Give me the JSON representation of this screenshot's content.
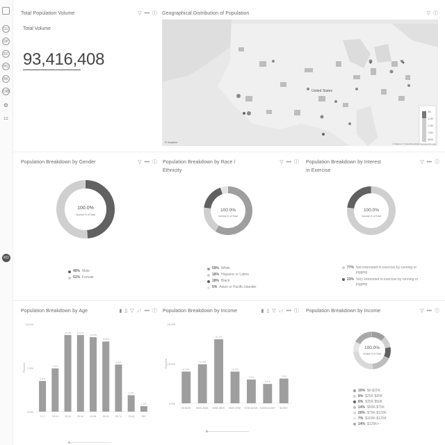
{
  "rail": {
    "items": [
      "CLI",
      "DP",
      "GC",
      "PO",
      "BK",
      "CRB"
    ],
    "user_initials": "KO"
  },
  "tools": {
    "filter": "▽",
    "more": "•••",
    "info": "ⓘ",
    "sort": "↓↑",
    "chart_icon": "▮",
    "grid_icon": "▯"
  },
  "total_volume": {
    "title": "Total Population Volume",
    "label": "Total Volume",
    "value": "93,416,408"
  },
  "map": {
    "title": "Geographical Distribution of Population",
    "country_label": "United States",
    "attribution": "© Mapbox © OpenStreetMap Improve this map",
    "logo": "© mapbox",
    "legend_values": [
      "4M",
      "3.2M",
      "2.4M",
      "1.6M",
      "800K"
    ]
  },
  "gender": {
    "title": "Population Breakdown by Gender",
    "center_value": "100.0%",
    "center_label": "Volume % of Total",
    "legend": [
      {
        "pct": "49%",
        "label": "Male"
      },
      {
        "pct": "51%",
        "label": "Female"
      }
    ]
  },
  "race": {
    "title_line1": "Population Breakdown by Race /",
    "title_line2": "Ethnicity",
    "center_value": "100.0%",
    "center_label": "Volume % of Total",
    "legend": [
      {
        "pct": "59%",
        "label": "White"
      },
      {
        "pct": "18%",
        "label": "Hispanic or Latino"
      },
      {
        "pct": "18%",
        "label": "Black"
      },
      {
        "pct": "5%",
        "label": "Asian or Pacific Islander"
      }
    ]
  },
  "exercise": {
    "title_line1": "Population Breakdown by Interest",
    "title_line2": "in Exercise",
    "center_value": "100.0%",
    "center_label": "Volume % of Total",
    "legend": [
      {
        "pct": "77%",
        "label": "Not interested in exercise by running or jogging"
      },
      {
        "pct": "23%",
        "label": "Very interested in exercise by running or jogging"
      }
    ]
  },
  "income_donut": {
    "title": "Population Breakdown by Income",
    "center_value": "100.0%",
    "center_label": "Volume % of Total",
    "legend": [
      {
        "pct": "10%",
        "label": "$0-$25K"
      },
      {
        "pct": "8%",
        "label": "$25K-$35K"
      },
      {
        "pct": "8%",
        "label": "$35K-$50K"
      },
      {
        "pct": "14%",
        "label": "$50K-$75K"
      },
      {
        "pct": "20%",
        "label": "$75K-$100K"
      },
      {
        "pct": "7%",
        "label": "$100K-$125K"
      },
      {
        "pct": "14%",
        "label": "$125K+"
      }
    ]
  },
  "colors": {
    "dark": "#616161",
    "mid": "#9e9e9e",
    "light": "#cfcfcf",
    "pale": "#e3e3e3"
  },
  "chart_data": [
    {
      "type": "bar",
      "title": "Population Breakdown by Age",
      "categories": [
        "18-24",
        "25-34",
        "35-44",
        "45-54",
        "55-64",
        "65-74",
        "75-84",
        "85+"
      ],
      "values": [
        5.6,
        7.9,
        14.0,
        14.0,
        13.6,
        12.8,
        8.6,
        3.0,
        1.0
      ],
      "value_labels": [
        "5.6%",
        "7.9%",
        "14.0%",
        "14.0%",
        "13.6%",
        "12.8%",
        "8.6%",
        "3.0%",
        "1.0%"
      ],
      "bar_categories": [
        "1-17",
        "18-24",
        "25-34",
        "35-44",
        "45-54",
        "55-64",
        "65-74",
        "75-84",
        "85+"
      ],
      "ylabel": "Percent",
      "yticks": [
        "0.0%",
        "7.5%",
        "15.0%"
      ],
      "ylim": [
        0,
        16
      ]
    },
    {
      "type": "bar",
      "title": "Population Breakdown by Income",
      "categories": [
        "$0-$25K",
        "$25K-$35K",
        "$35K-$50K",
        "$50K-$75K",
        "$75K-$100K",
        "$100K-$125K",
        "$125K+"
      ],
      "values": [
        10.0,
        12.3,
        20.2,
        10.0,
        7.5,
        6.1,
        7.8
      ],
      "value_labels": [
        "10.0%",
        "12.3%",
        "20.2%",
        "10.0%",
        "7.5%",
        "6.1%",
        "7.8%"
      ],
      "ylabel": "Percent",
      "yticks": [
        "0.0%",
        "12.5%",
        "25.0%"
      ],
      "ylim": [
        0,
        25
      ]
    },
    {
      "type": "pie",
      "title": "Population Breakdown by Gender",
      "categories": [
        "Male",
        "Female"
      ],
      "values": [
        49,
        51
      ]
    },
    {
      "type": "pie",
      "title": "Population Breakdown by Race / Ethnicity",
      "categories": [
        "White",
        "Hispanic or Latino",
        "Black",
        "Asian or Pacific Islander"
      ],
      "values": [
        59,
        18,
        18,
        5
      ]
    },
    {
      "type": "pie",
      "title": "Population Breakdown by Interest in Exercise",
      "categories": [
        "Not interested in exercise by running or jogging",
        "Very interested in exercise by running or jogging"
      ],
      "values": [
        77,
        23
      ]
    },
    {
      "type": "pie",
      "title": "Population Breakdown by Income",
      "categories": [
        "$0-$25K",
        "$25K-$35K",
        "$35K-$50K",
        "$50K-$75K",
        "$75K-$100K",
        "$100K-$125K",
        "$125K+"
      ],
      "values": [
        10,
        8,
        8,
        14,
        20,
        7,
        14
      ]
    }
  ]
}
